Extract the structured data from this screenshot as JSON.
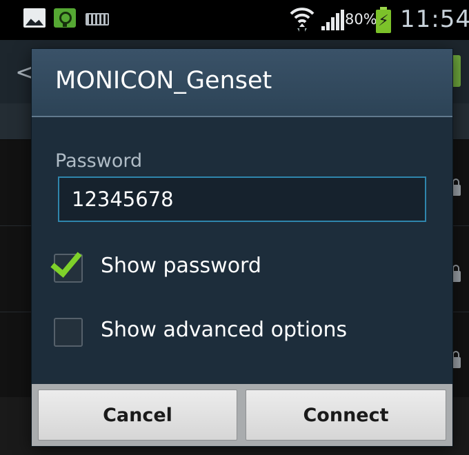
{
  "status_bar": {
    "battery_percent": "80%",
    "time": "11:54",
    "icons": [
      "gallery-icon",
      "sync-icon",
      "keyboard-icon",
      "wifi-icon",
      "signal-icon",
      "battery-charging-icon"
    ]
  },
  "dialog": {
    "title": "MONICON_Genset",
    "password_label": "Password",
    "password_value": "12345678",
    "show_password": {
      "label": "Show password",
      "checked": true
    },
    "show_advanced": {
      "label": "Show advanced options",
      "checked": false
    },
    "cancel_label": "Cancel",
    "connect_label": "Connect"
  },
  "colors": {
    "dialog_bg": "#1d2d3b",
    "header_bg": "#2c4356",
    "input_border": "#2f86ad",
    "check_green": "#7fd12a",
    "button_bg": "#e4e4e4"
  }
}
